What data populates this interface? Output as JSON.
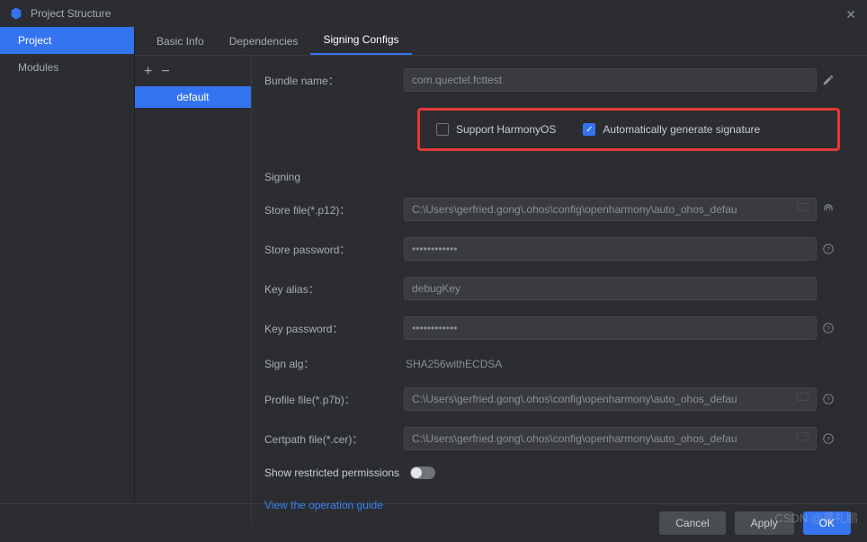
{
  "titlebar": {
    "title": "Project Structure"
  },
  "leftnav": {
    "items": [
      "Project",
      "Modules"
    ],
    "selected": 0
  },
  "tabs": {
    "items": [
      "Basic Info",
      "Dependencies",
      "Signing Configs"
    ],
    "selected": 2
  },
  "configlist": {
    "items": [
      "default"
    ],
    "selected": 0
  },
  "form": {
    "bundle_name_label": "Bundle name：",
    "bundle_name_value": "com.quectel.fcttest",
    "support_harmony_label": "Support HarmonyOS",
    "support_harmony_checked": false,
    "auto_sign_label": "Automatically generate signature",
    "auto_sign_checked": true,
    "signing_section": "Signing",
    "store_file_label": "Store file(*.p12)：",
    "store_file_value": "C:\\Users\\gerfried.gong\\.ohos\\config\\openharmony\\auto_ohos_defau",
    "store_password_label": "Store password：",
    "store_password_value": "••••••••••••",
    "key_alias_label": "Key alias：",
    "key_alias_value": "debugKey",
    "key_password_label": "Key password：",
    "key_password_value": "••••••••••••",
    "sign_alg_label": "Sign alg：",
    "sign_alg_value": "SHA256withECDSA",
    "profile_file_label": "Profile file(*.p7b)：",
    "profile_file_value": "C:\\Users\\gerfried.gong\\.ohos\\config\\openharmony\\auto_ohos_defau",
    "certpath_label": "Certpath file(*.cer)：",
    "certpath_value": "C:\\Users\\gerfried.gong\\.ohos\\config\\openharmony\\auto_ohos_defau",
    "restricted_label": "Show restricted permissions",
    "guide_link": "View the operation guide"
  },
  "footer": {
    "cancel": "Cancel",
    "apply": "Apply",
    "ok": "OK"
  },
  "watermark": "CSDN @龚礼鹏"
}
